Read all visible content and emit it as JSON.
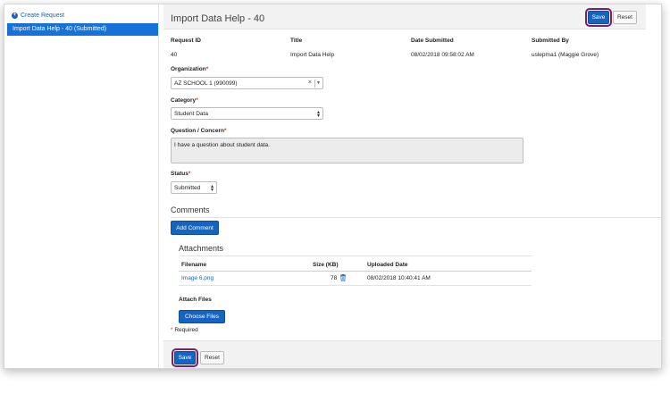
{
  "sidebar": {
    "create_link": "Create Request",
    "items": [
      {
        "label": "Import Data Help - 40 (Submitted)"
      }
    ]
  },
  "header": {
    "title": "Import Data Help - 40",
    "save_label": "Save",
    "reset_label": "Reset"
  },
  "summary": {
    "headers": [
      "Request ID",
      "Title",
      "Date Submitted",
      "Submitted By"
    ],
    "values": [
      "40",
      "Import Data Help",
      "08/02/2018 09:58:02 AM",
      "uslepma1 (Maggie Grove)"
    ]
  },
  "form": {
    "organization_label": "Organization",
    "organization_value": "AZ SCHOOL 1 (990099)",
    "category_label": "Category",
    "category_value": "Student Data",
    "question_label": "Question / Concern",
    "question_value": "I have a question about student data.",
    "status_label": "Status",
    "status_value": "Submitted",
    "required_marker": "*"
  },
  "comments": {
    "heading": "Comments",
    "add_label": "Add Comment"
  },
  "attachments": {
    "heading": "Attachments",
    "columns": [
      "Filename",
      "Size (KB)",
      "Uploaded Date"
    ],
    "rows": [
      {
        "filename": "Image 6.png",
        "size": "78",
        "uploaded": "08/02/2018 10:40:41 AM"
      }
    ],
    "attach_label": "Attach Files",
    "choose_label": "Choose Files"
  },
  "required_note": "Required",
  "footer": {
    "save_label": "Save",
    "reset_label": "Reset"
  },
  "colors": {
    "accent": "#1565c0",
    "sidebar_selected": "#1672d9",
    "highlight": "#7b1f6a",
    "required": "#d32f2f"
  },
  "icons": {
    "create": "plus-circle-icon",
    "delete": "trash-icon",
    "clear": "close-icon",
    "dropdown": "chevron-down-icon"
  }
}
